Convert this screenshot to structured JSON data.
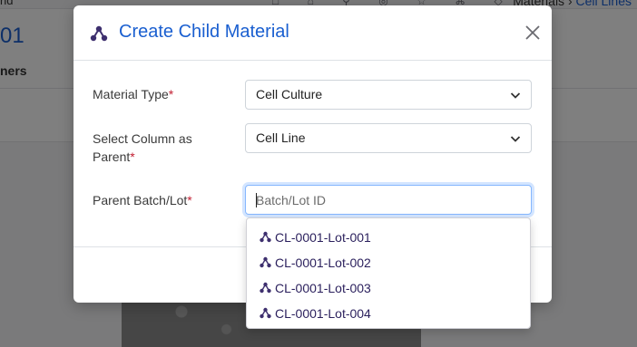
{
  "background": {
    "nav_stub": "rid",
    "breadcrumb": {
      "root": "Materials",
      "separator": "›",
      "current": "Cell Lines"
    },
    "page_title_fragment": "01",
    "tab_fragment": "ners"
  },
  "modal": {
    "title": "Create Child Material",
    "icon": "molecule-icon",
    "close_icon": "close-icon",
    "fields": {
      "material_type": {
        "label": "Material Type",
        "required_mark": "*",
        "value": "Cell Culture"
      },
      "parent_column": {
        "label_line1": "Select Column as",
        "label_line2": "Parent",
        "required_mark": "*",
        "value": "Cell Line"
      },
      "parent_batch": {
        "label": "Parent Batch/Lot",
        "required_mark": "*",
        "value": "",
        "placeholder": "Batch/Lot ID"
      }
    },
    "dropdown": {
      "items": [
        {
          "label": "CL-0001-Lot-001"
        },
        {
          "label": "CL-0001-Lot-002"
        },
        {
          "label": "CL-0001-Lot-003"
        },
        {
          "label": "CL-0001-Lot-004"
        }
      ]
    }
  },
  "colors": {
    "accent": "#1a5fd0",
    "required": "#c21f32",
    "dropdown_text": "#2a1f5c",
    "icon": "#3d2f6e"
  }
}
